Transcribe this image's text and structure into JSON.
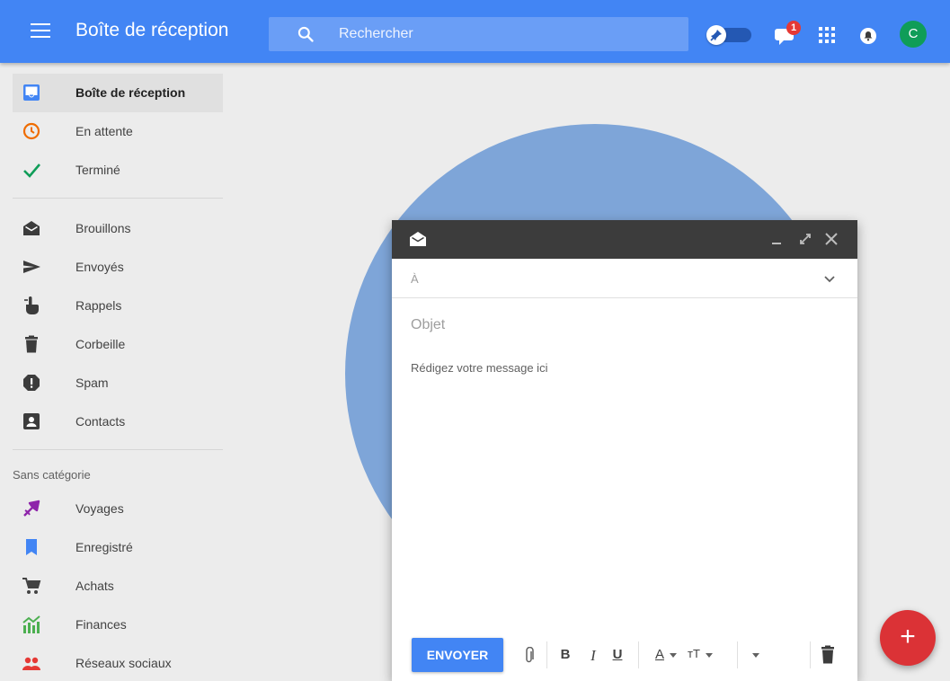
{
  "header": {
    "title": "Boîte de réception",
    "search_placeholder": "Rechercher",
    "chat_badge": "1",
    "avatar_initial": "C"
  },
  "sidebar": {
    "items": [
      {
        "label": "Boîte de réception",
        "icon": "inbox-icon",
        "active": true
      },
      {
        "label": "En attente",
        "icon": "clock-icon"
      },
      {
        "label": "Terminé",
        "icon": "check-icon"
      },
      {
        "label": "Brouillons",
        "icon": "drafts-icon"
      },
      {
        "label": "Envoyés",
        "icon": "send-icon"
      },
      {
        "label": "Rappels",
        "icon": "reminder-icon"
      },
      {
        "label": "Corbeille",
        "icon": "trash-icon"
      },
      {
        "label": "Spam",
        "icon": "spam-icon"
      },
      {
        "label": "Contacts",
        "icon": "contacts-icon"
      }
    ],
    "section_label": "Sans catégorie",
    "categories": [
      {
        "label": "Voyages",
        "icon": "flight-icon",
        "color": "#8e24aa"
      },
      {
        "label": "Enregistré",
        "icon": "bookmark-icon",
        "color": "#4285f4"
      },
      {
        "label": "Achats",
        "icon": "cart-icon",
        "color": "#424242"
      },
      {
        "label": "Finances",
        "icon": "finance-icon",
        "color": "#4caf50"
      },
      {
        "label": "Réseaux sociaux",
        "icon": "social-icon",
        "color": "#e53935"
      }
    ]
  },
  "compose": {
    "to_label": "À",
    "subject_placeholder": "Objet",
    "body_placeholder": "Rédigez votre message ici",
    "send_label": "ENVOYER",
    "bold": "B",
    "italic": "I",
    "underline": "U",
    "text_color": "A",
    "text_size": "тT"
  },
  "fab_label": "+",
  "colors": {
    "header": "#4285f4",
    "send": "#4285f4",
    "fab": "#db3236",
    "avatar": "#0f9d58"
  }
}
